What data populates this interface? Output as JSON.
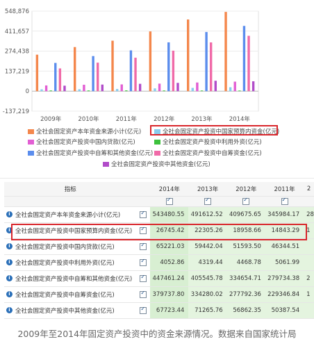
{
  "chart_data": {
    "type": "bar",
    "categories": [
      "2009年",
      "2010年",
      "2011年",
      "2012年",
      "2013年",
      "2014年"
    ],
    "y_ticks": [
      "548,876",
      "411,657",
      "274,438",
      "137,219",
      "0",
      "-137,219"
    ],
    "ylim": [
      -137219,
      548876
    ],
    "series": [
      {
        "name": "全社会固定资产本年资金来源小计(亿元)",
        "color": "#f4874c",
        "values": [
          250229.7,
          302396.1,
          345984.17,
          409675.65,
          491612.52,
          543480.55
        ]
      },
      {
        "name": "全社会固定资产投资中国家预算内资金(亿元)",
        "color": "#88cdee",
        "values": [
          12685.7,
          13012.7,
          14843.29,
          18958.66,
          22305.26,
          26745.42
        ]
      },
      {
        "name": "全社会固定资产投资中国内贷款(亿元)",
        "color": "#e25ed3",
        "values": [
          39302.8,
          44020.8,
          46344.51,
          51593.5,
          59442.04,
          65221.03
        ]
      },
      {
        "name": "全社会固定资产投资中利用外资(亿元)",
        "color": "#3cc13c",
        "values": [
          4623.7,
          4703.6,
          5061.99,
          4468.78,
          4319.44,
          4052.86
        ]
      },
      {
        "name": "全社会固定资产投资中自筹和其他资金(亿元)",
        "color": "#5b8ded",
        "values": [
          193617.5,
          240659.0,
          279734.38,
          334654.71,
          405545.78,
          447461.24
        ]
      },
      {
        "name": "全社会固定资产投资中自筹资金(亿元)",
        "color": "#f06aa8",
        "values": [
          156011.4,
          195452.1,
          229346.84,
          277792.36,
          334280.02,
          379737.8
        ]
      },
      {
        "name": "全社会固定资产投资中其他资金(亿元)",
        "color": "#b14cc9",
        "values": [
          37606.1,
          45206.9,
          50387.54,
          56862.35,
          71265.76,
          67723.44
        ]
      }
    ]
  },
  "legend": [
    "全社会固定资产本年资金来源小计(亿元)",
    "全社会固定资产投资中国家预算内资金(亿元)",
    "全社会固定资产投资中国内贷款(亿元)",
    "全社会固定资产投资中利用外资(亿元)",
    "全社会固定资产投资中自筹和其他资金(亿元)",
    "全社会固定资产投资中自筹资金(亿元)",
    "全社会固定资产投资中其他资金(亿元)"
  ],
  "table": {
    "header_label": "指标",
    "years": [
      "2014年",
      "2013年",
      "2012年",
      "2011年",
      "2"
    ],
    "rows": [
      {
        "label": "全社会固定资产本年资金来源小计(亿元)",
        "values": [
          "543480.55",
          "491612.52",
          "409675.65",
          "345984.17",
          "28"
        ]
      },
      {
        "label": "全社会固定资产投资中国家预算内资金(亿元)",
        "values": [
          "26745.42",
          "22305.26",
          "18958.66",
          "14843.29",
          "1"
        ]
      },
      {
        "label": "全社会固定资产投资中国内贷款(亿元)",
        "values": [
          "65221.03",
          "59442.04",
          "51593.50",
          "46344.51",
          ""
        ]
      },
      {
        "label": "全社会固定资产投资中利用外资(亿元)",
        "values": [
          "4052.86",
          "4319.44",
          "4468.78",
          "5061.99",
          ""
        ]
      },
      {
        "label": "全社会固定资产投资中自筹和其他资金(亿元)",
        "values": [
          "447461.24",
          "405545.78",
          "334654.71",
          "279734.38",
          "2"
        ]
      },
      {
        "label": "全社会固定资产投资中自筹资金(亿元)",
        "values": [
          "379737.80",
          "334280.02",
          "277792.36",
          "229346.84",
          "1"
        ]
      },
      {
        "label": "全社会固定资产投资中其他资金(亿元)",
        "values": [
          "67723.44",
          "71265.76",
          "56862.35",
          "50387.54",
          ""
        ]
      }
    ]
  },
  "caption": "2009年至2014年固定资产投资中的资金来源情况。数据来自国家统计局"
}
